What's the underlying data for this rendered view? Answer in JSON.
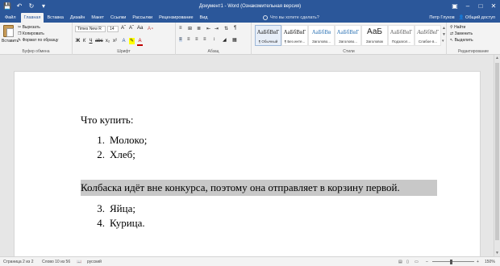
{
  "title_bar": {
    "document_title": "Документ1 - Word (Ознакомительная версия)",
    "qat_icons": [
      "save-icon",
      "undo-icon",
      "redo-icon",
      "customize-icon"
    ],
    "window_controls": [
      "ribbon-display-icon",
      "minimize-icon",
      "maximize-icon",
      "close-icon"
    ]
  },
  "tabs": [
    "Файл",
    "Главная",
    "Вставка",
    "Дизайн",
    "Макет",
    "Ссылки",
    "Рассылки",
    "Рецензирование",
    "Вид"
  ],
  "active_tab": "Главная",
  "tell_me": "Что вы хотите сделать?",
  "account": {
    "user": "Петр Глухов",
    "share": "Общий доступ"
  },
  "ribbon": {
    "clipboard": {
      "paste": "Вставить",
      "cut": "Вырезать",
      "copy": "Копировать",
      "format_painter": "Формат по образцу",
      "label": "Буфер обмена"
    },
    "font": {
      "font_name": "Times New R",
      "font_size": "14",
      "label": "Шрифт"
    },
    "paragraph": {
      "label": "Абзац"
    },
    "styles": {
      "items": [
        {
          "sample": "АаБбВвГ",
          "name": "¶ Обычный"
        },
        {
          "sample": "АаБбВвГ",
          "name": "¶ Без инте..."
        },
        {
          "sample": "АаБбВв",
          "name": "Заголово..."
        },
        {
          "sample": "АаБбВвГ",
          "name": "Заголово..."
        },
        {
          "sample": "АаБ",
          "name": "Заголовок"
        },
        {
          "sample": "АаБбВвГ",
          "name": "Подзагол..."
        },
        {
          "sample": "АаБбВвГ",
          "name": "Слабое в..."
        }
      ],
      "label": "Стили"
    },
    "editing": {
      "find": "Найти",
      "replace": "Заменить",
      "select": "Выделить",
      "label": "Редактирование"
    }
  },
  "document": {
    "heading": "Что купить:",
    "list_a": [
      {
        "num": "1.",
        "text": "Молоко;"
      },
      {
        "num": "2.",
        "text": "Хлеб;"
      }
    ],
    "highlighted_paragraph": "Колбаска идёт вне конкурса, поэтому она отправляет в корзину первой.",
    "list_b": [
      {
        "num": "3.",
        "text": "Яйца;"
      },
      {
        "num": "4.",
        "text": "Курица."
      }
    ]
  },
  "status_bar": {
    "page": "Страница 2 из 2",
    "words": "Слово 10 из 56",
    "language": "русский",
    "zoom": "150%"
  },
  "colors": {
    "accent": "#2b579a",
    "ribbon_bg": "#f3f3f3",
    "highlight": "#c8c8c8"
  }
}
